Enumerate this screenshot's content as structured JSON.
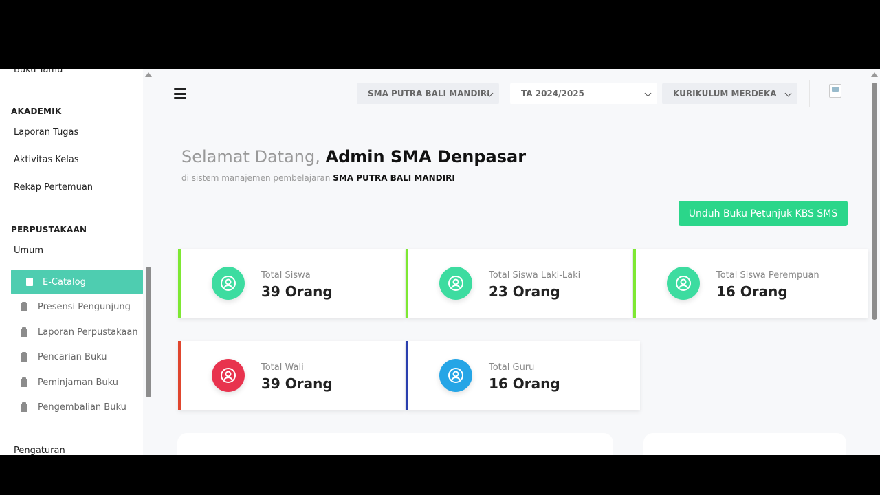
{
  "sidebar": {
    "cut_item": "Buku Tamu",
    "sections": [
      {
        "heading": "AKADEMIK",
        "items": [
          "Laporan Tugas",
          "Aktivitas Kelas",
          "Rekap Pertemuan"
        ]
      },
      {
        "heading": "PERPUSTAKAAN",
        "items": [
          "Umum"
        ]
      }
    ],
    "library_items": [
      "E-Catalog",
      "Presensi Pengunjung",
      "Laporan Perpustakaan",
      "Pencarian Buku",
      "Peminjaman Buku",
      "Pengembalian Buku"
    ],
    "bottom_item": "Pengaturan"
  },
  "topbar": {
    "school_select": "SMA PUTRA BALI MANDIRI",
    "year_select": "TA 2024/2025",
    "curriculum_select": "KURIKULUM MERDEKA"
  },
  "welcome": {
    "greeting": "Selamat Datang,",
    "name": "Admin SMA Denpasar",
    "subtitle_prefix": "di sistem manajemen pembelajaran",
    "subtitle_school": "SMA PUTRA BALI MANDIRI"
  },
  "download_button": "Unduh Buku Petunjuk KBS SMS",
  "stats": [
    {
      "label": "Total Siswa",
      "value": "39 Orang",
      "accent": "#7ee833",
      "icon_color": "#3ddca0"
    },
    {
      "label": "Total Siswa Laki-Laki",
      "value": "23 Orang",
      "accent": "#7ee833",
      "icon_color": "#3ddca0"
    },
    {
      "label": "Total Siswa Perempuan",
      "value": "16 Orang",
      "accent": "#7ee833",
      "icon_color": "#3ddca0"
    },
    {
      "label": "Total Wali",
      "value": "39 Orang",
      "accent": "#e0462e",
      "icon_color": "#e8334e"
    },
    {
      "label": "Total Guru",
      "value": "16 Orang",
      "accent": "#2a3fae",
      "icon_color": "#25a5e6"
    }
  ]
}
